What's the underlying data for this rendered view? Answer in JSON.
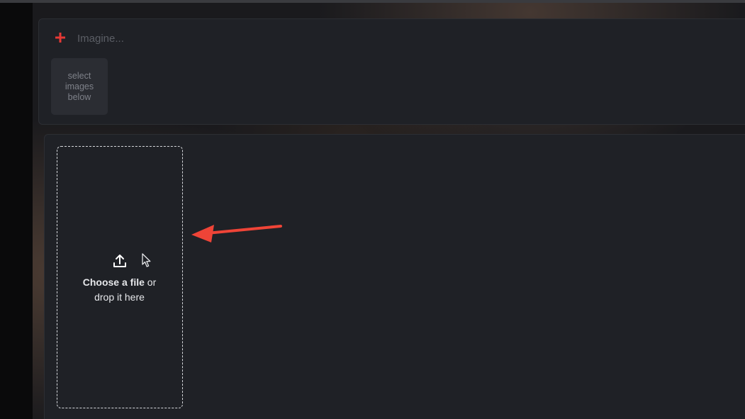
{
  "prompt": {
    "placeholder": "Imagine..."
  },
  "select_images_tile": {
    "label": "select images below"
  },
  "dropzone": {
    "choose_label": "Choose a file",
    "connector": "or",
    "drop_label": "drop it here"
  },
  "icons": {
    "add": "plus-icon",
    "upload": "upload-icon",
    "cursor": "mouse-cursor-icon",
    "annotation": "red-arrow-icon"
  },
  "colors": {
    "accent_red": "#e53935",
    "annotation_red": "#ef4437"
  }
}
